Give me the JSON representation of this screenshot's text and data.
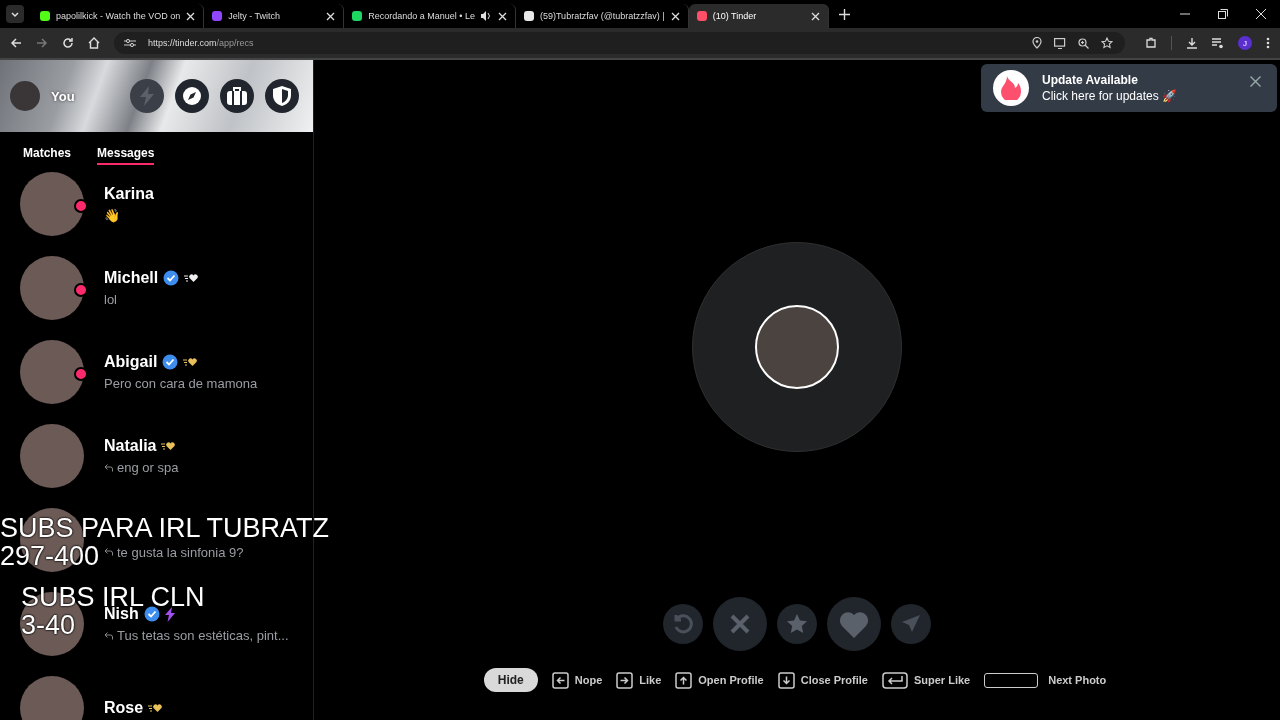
{
  "browser": {
    "tabs": [
      {
        "title": "papolilkick - Watch the VOD on",
        "color": "#53fc18",
        "audio": false,
        "selected": false
      },
      {
        "title": "Jelty - Twitch",
        "color": "#9146ff",
        "audio": false,
        "selected": false
      },
      {
        "title": "Recordando a Manuel • Le",
        "color": "#1ed760",
        "audio": true,
        "selected": false
      },
      {
        "title": "(59)Tubratzfav (@tubratzzfav) |",
        "color": "#e8e8e8",
        "audio": false,
        "selected": false
      },
      {
        "title": "(10) Tinder",
        "color": "#fd5068",
        "audio": false,
        "selected": true
      }
    ],
    "url_host": "https://tinder.com",
    "url_path": "/app/recs",
    "profile_initial": "J"
  },
  "sidebar": {
    "user": "You",
    "tabs": [
      {
        "label": "Matches",
        "selected": false
      },
      {
        "label": "Messages",
        "selected": true
      }
    ],
    "messages": [
      {
        "name": "Karina",
        "preview": "👋",
        "online": true,
        "verified": false,
        "replied": false
      },
      {
        "name": "Michell",
        "preview": "lol",
        "online": true,
        "verified": true,
        "badge": {
          "kind": "heart",
          "color": "#eeeeee"
        },
        "replied": false
      },
      {
        "name": "Abigail",
        "preview": "Pero con cara de mamona",
        "online": true,
        "verified": true,
        "badge": {
          "kind": "heart",
          "color": "#e8c15a"
        },
        "replied": false
      },
      {
        "name": "Natalia",
        "preview": "eng or spa",
        "online": false,
        "verified": false,
        "badge": {
          "kind": "heart",
          "color": "#e8c15a"
        },
        "replied": true
      },
      {
        "preview": "te gusta la sinfonia 9?",
        "online": false,
        "verified": false,
        "replied": true
      },
      {
        "name": "Nish",
        "preview": "Tus tetas son estéticas, pint...",
        "online": false,
        "verified": true,
        "badge": {
          "kind": "bolt",
          "color": "#a34ff0"
        },
        "replied": true
      },
      {
        "name": "Rose",
        "online": false,
        "verified": false,
        "badge": {
          "kind": "heart",
          "color": "#e8c15a"
        },
        "replied": false
      }
    ]
  },
  "toast": {
    "title": "Update Available",
    "text": "Click here for updates 🚀"
  },
  "shortcuts": {
    "hide": "Hide",
    "items": [
      {
        "kind": "left",
        "label": "Nope"
      },
      {
        "kind": "right",
        "label": "Like"
      },
      {
        "kind": "up",
        "label": "Open Profile"
      },
      {
        "kind": "down",
        "label": "Close Profile"
      },
      {
        "kind": "enter",
        "label": "Super Like"
      },
      {
        "kind": "space",
        "label": "Next Photo"
      }
    ]
  },
  "stream_overlay": [
    {
      "lines": [
        "SUBS PARA IRL TUBRATZ",
        "297-400"
      ]
    },
    {
      "lines": [
        "SUBS IRL CLN",
        "3-40"
      ]
    }
  ]
}
